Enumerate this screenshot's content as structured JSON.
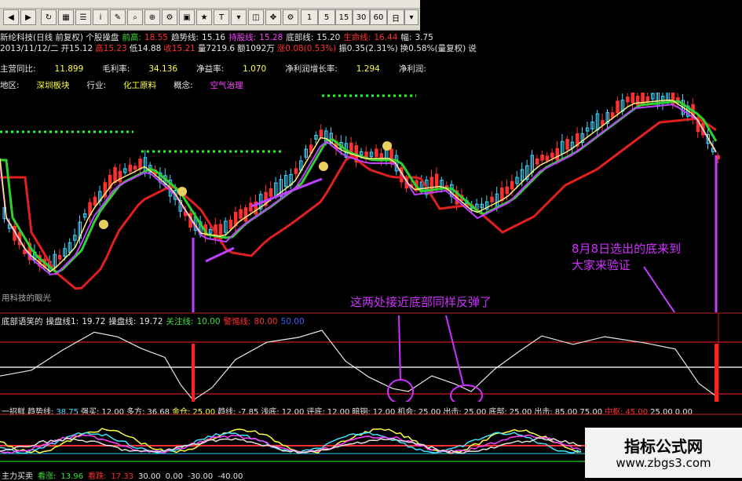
{
  "toolbar": {
    "buttons": [
      "1",
      "5",
      "15",
      "30",
      "60",
      "日"
    ]
  },
  "header": {
    "row1": [
      {
        "t": "新纶科技(日线 前复权) 个股操盘",
        "c": "w"
      },
      {
        "t": "前高:",
        "c": "g"
      },
      {
        "t": "18.55",
        "c": "r"
      },
      {
        "t": "趋势线:",
        "c": "w"
      },
      {
        "t": "15.16",
        "c": "w"
      },
      {
        "t": "持股线:",
        "c": "m"
      },
      {
        "t": "15.28",
        "c": "m"
      },
      {
        "t": "底部线:",
        "c": "w"
      },
      {
        "t": "15.20",
        "c": "w"
      },
      {
        "t": "生命线:",
        "c": "r"
      },
      {
        "t": "16.44",
        "c": "r"
      },
      {
        "t": "幅:",
        "c": "w"
      },
      {
        "t": "3.75",
        "c": "w"
      }
    ],
    "row2": [
      {
        "t": "2013/11/12/二",
        "c": "w"
      },
      {
        "t": "开15.12",
        "c": "w"
      },
      {
        "t": "高15.23",
        "c": "r"
      },
      {
        "t": "低14.88",
        "c": "w"
      },
      {
        "t": "收15.21",
        "c": "r"
      },
      {
        "t": "量7219.6",
        "c": "w"
      },
      {
        "t": "额1092万",
        "c": "w"
      },
      {
        "t": "涨0.08(0.53%)",
        "c": "r"
      },
      {
        "t": "振0.35(2.31%)",
        "c": "w"
      },
      {
        "t": "换0.58%(量复权)",
        "c": "w"
      },
      {
        "t": "说",
        "c": "w"
      }
    ],
    "row3": [
      {
        "t": "主营同比:",
        "c": "w"
      },
      {
        "t": "11.899",
        "c": "y"
      },
      {
        "t": "毛利率:",
        "c": "w"
      },
      {
        "t": "34.136",
        "c": "y"
      },
      {
        "t": "净益率:",
        "c": "w"
      },
      {
        "t": "1.070",
        "c": "y"
      },
      {
        "t": "净利润增长率:",
        "c": "w"
      },
      {
        "t": "1.294",
        "c": "y"
      },
      {
        "t": "净利润:",
        "c": "w"
      }
    ],
    "row4": [
      {
        "t": "地区:",
        "c": "w"
      },
      {
        "t": "深圳板块",
        "c": "y"
      },
      {
        "t": "行业:",
        "c": "w"
      },
      {
        "t": "化工原料",
        "c": "y"
      },
      {
        "t": "概念:",
        "c": "w"
      },
      {
        "t": "空气治理",
        "c": "m"
      }
    ]
  },
  "main_chart": {
    "bottom_left_label": "用科技的眼光",
    "annotation_right": [
      "8月8日选出的底来到",
      "大家来验证"
    ],
    "colors": {
      "ma_red": "#e02020",
      "ma_green": "#30d030",
      "ma_purple": "#c040ff",
      "ma_yellow": "#fff080",
      "candle_up": "#40d8ff",
      "candle_down": "#ff3030",
      "dots": "#20ff20"
    }
  },
  "oscillator": {
    "legend": [
      {
        "t": "底部语笑的",
        "c": "w"
      },
      {
        "t": "操盘线1:",
        "c": "w"
      },
      {
        "t": "19.72",
        "c": "w"
      },
      {
        "t": "操盘线:",
        "c": "w"
      },
      {
        "t": "19.72",
        "c": "w"
      },
      {
        "t": "关注线:",
        "c": "g"
      },
      {
        "t": "10.00",
        "c": "g"
      },
      {
        "t": "警惕线:",
        "c": "r"
      },
      {
        "t": "80.00",
        "c": "r"
      },
      {
        "t": "50.00",
        "c": "b"
      }
    ],
    "annotation": "这两处接近底部同样反弹了"
  },
  "lower_indicator": {
    "legend": [
      {
        "t": "一招鲜",
        "c": "w"
      },
      {
        "t": "趋势线:",
        "c": "w"
      },
      {
        "t": "38.75",
        "c": "c"
      },
      {
        "t": "强买:",
        "c": "w"
      },
      {
        "t": "12.00",
        "c": "w"
      },
      {
        "t": "多方:",
        "c": "w"
      },
      {
        "t": "36.68",
        "c": "w"
      },
      {
        "t": "金仓:",
        "c": "y"
      },
      {
        "t": "25.00",
        "c": "y"
      },
      {
        "t": "趋线:",
        "c": "w"
      },
      {
        "t": "-7.85",
        "c": "w"
      },
      {
        "t": "浅底:",
        "c": "w"
      },
      {
        "t": "12.00",
        "c": "w"
      },
      {
        "t": "评底:",
        "c": "w"
      },
      {
        "t": "12.00",
        "c": "w"
      },
      {
        "t": "暗铜:",
        "c": "w"
      },
      {
        "t": "12.00",
        "c": "w"
      },
      {
        "t": "机会:",
        "c": "w"
      },
      {
        "t": "25.00",
        "c": "w"
      },
      {
        "t": "出击:",
        "c": "w"
      },
      {
        "t": "25.00",
        "c": "w"
      },
      {
        "t": "底部:",
        "c": "w"
      },
      {
        "t": "25.00",
        "c": "w"
      },
      {
        "t": "出击:",
        "c": "w"
      },
      {
        "t": "85.00",
        "c": "w"
      },
      {
        "t": "75.00",
        "c": "w"
      },
      {
        "t": "中枢:",
        "c": "r"
      },
      {
        "t": "45.00",
        "c": "r"
      },
      {
        "t": "25.00",
        "c": "w"
      },
      {
        "t": "0.00",
        "c": "w"
      }
    ],
    "bottom_legend": [
      {
        "t": "主力买卖",
        "c": "w"
      },
      {
        "t": "看涨:",
        "c": "g"
      },
      {
        "t": "13.96",
        "c": "g"
      },
      {
        "t": "看跌:",
        "c": "r"
      },
      {
        "t": "17.33",
        "c": "r"
      },
      {
        "t": "30.00",
        "c": "w"
      },
      {
        "t": "0.00",
        "c": "w"
      },
      {
        "t": "-30.00",
        "c": "w"
      },
      {
        "t": "-40.00",
        "c": "w"
      }
    ]
  },
  "watermark": {
    "line1": "指标公式网",
    "line2": "www.zbgs3.com"
  }
}
